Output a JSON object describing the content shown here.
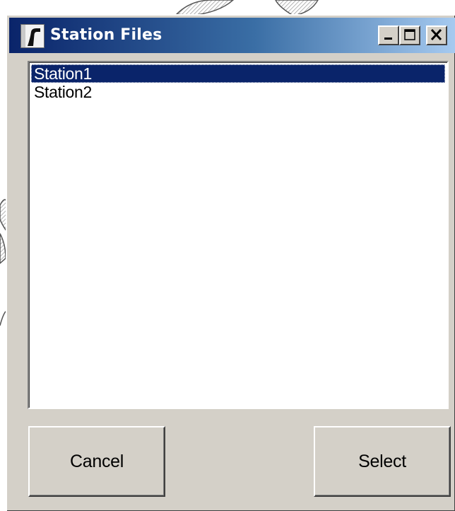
{
  "window": {
    "title": "Station Files",
    "icon": "app-icon",
    "controls": {
      "minimize_icon": "minimize-icon",
      "maximize_icon": "maximize-icon",
      "close_icon": "close-icon"
    }
  },
  "station_list": {
    "items": [
      {
        "label": "Station1",
        "selected": true
      },
      {
        "label": "Station2",
        "selected": false
      }
    ]
  },
  "buttons": {
    "cancel_label": "Cancel",
    "select_label": "Select"
  },
  "colors": {
    "face": "#d4d0c8",
    "titlebar_start": "#0a246a",
    "titlebar_end": "#a6caf0",
    "selection": "#0a246a"
  }
}
